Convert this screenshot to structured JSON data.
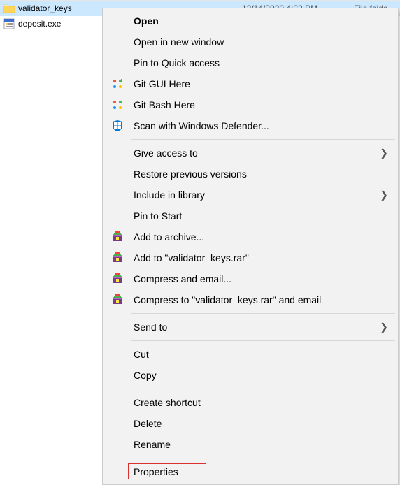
{
  "files": [
    {
      "name": "validator_keys",
      "date": "12/14/2020 4:23 PM",
      "type": "File folde",
      "icon": "folder"
    },
    {
      "name": "deposit.exe",
      "date": "",
      "type": "",
      "icon": "exe"
    }
  ],
  "menu": {
    "open": "Open",
    "open_new_window": "Open in new window",
    "pin_quick_access": "Pin to Quick access",
    "git_gui": "Git GUI Here",
    "git_bash": "Git Bash Here",
    "scan_defender": "Scan with Windows Defender...",
    "give_access": "Give access to",
    "restore_previous": "Restore previous versions",
    "include_library": "Include in library",
    "pin_start": "Pin to Start",
    "add_archive": "Add to archive...",
    "add_named_rar": "Add to \"validator_keys.rar\"",
    "compress_email": "Compress and email...",
    "compress_named_email": "Compress to \"validator_keys.rar\" and email",
    "send_to": "Send to",
    "cut": "Cut",
    "copy": "Copy",
    "create_shortcut": "Create shortcut",
    "delete": "Delete",
    "rename": "Rename",
    "properties": "Properties"
  }
}
